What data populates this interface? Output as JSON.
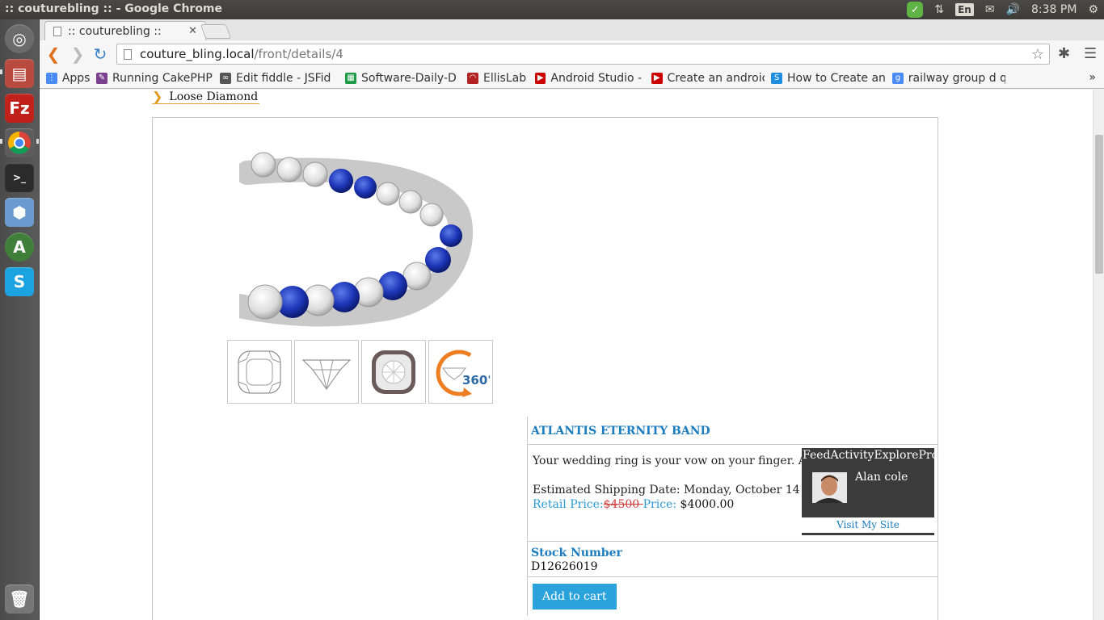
{
  "os": {
    "window_title": ":: couturebling :: - Google Chrome",
    "clock": "8:38 PM",
    "language": "En"
  },
  "browser": {
    "tab_title": ":: couturebling ::",
    "url_host": "couture_bling.local",
    "url_path": "/front/details/4",
    "bookmarks": [
      {
        "label": "Apps",
        "color": "#4a8af4"
      },
      {
        "label": "Running CakePHP",
        "color": "#7a3f8f"
      },
      {
        "label": "Edit fiddle - JSFid",
        "color": "#555555"
      },
      {
        "label": "Software-Daily-D",
        "color": "#1d9a45"
      },
      {
        "label": "EllisLab",
        "color": "#b22222"
      },
      {
        "label": "Android Studio - /",
        "color": "#cc0000"
      },
      {
        "label": "Create an androic",
        "color": "#cc0000"
      },
      {
        "label": "How to Create an",
        "color": "#1f8ee0"
      },
      {
        "label": "railway group d q",
        "color": "#4a8af4"
      }
    ]
  },
  "page": {
    "breadcrumb": "Loose Diamond",
    "product": {
      "title": "ATLANTIS ETERNITY BAND",
      "description": "Your wedding ring is your vow on your finger. At Gem",
      "shipping": "Estimated Shipping Date: Monday, October 14",
      "retail_label": "Retail Price:",
      "retail_price": "$4500 ",
      "price_label": "Price:",
      "price": "$4000.00",
      "stock_label": "Stock Number",
      "stock_number": "D12626019",
      "add_to_cart": "Add to cart",
      "thumb_360_label": "360°"
    },
    "profile": {
      "tabs": [
        "Feed",
        "Activity",
        "Explore",
        "Profile"
      ],
      "name": "Alan cole",
      "visit_link": "Visit My Site"
    }
  },
  "colors": {
    "accent_blue": "#1b7cbf",
    "button_blue": "#2aa3dc",
    "strike_red": "#d23c3c",
    "breadcrumb_orange": "#e39a1f"
  }
}
